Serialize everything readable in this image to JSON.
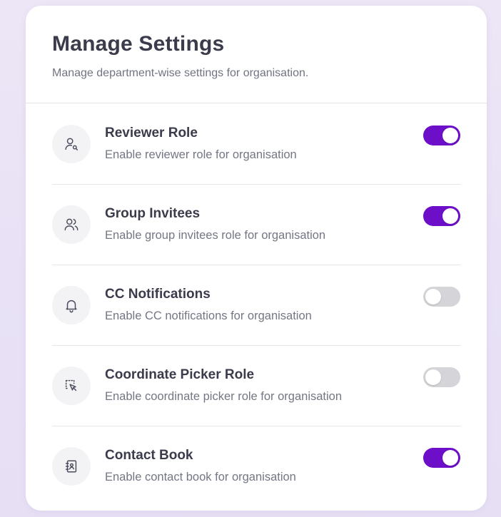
{
  "page": {
    "title": "Manage Settings",
    "subtitle": "Manage department-wise settings for organisation."
  },
  "settings": [
    {
      "icon": "user-search-icon",
      "title": "Reviewer Role",
      "description": "Enable reviewer role for organisation",
      "enabled": true
    },
    {
      "icon": "users-icon",
      "title": "Group Invitees",
      "description": "Enable group invitees role for organisation",
      "enabled": true
    },
    {
      "icon": "bell-icon",
      "title": "CC Notifications",
      "description": "Enable CC notifications for organisation",
      "enabled": false
    },
    {
      "icon": "selection-cursor-icon",
      "title": "Coordinate Picker Role",
      "description": "Enable coordinate picker role for organisation",
      "enabled": false
    },
    {
      "icon": "contact-book-icon",
      "title": "Contact Book",
      "description": "Enable contact book for organisation",
      "enabled": true
    }
  ],
  "colors": {
    "toggle_on": "#6d0fc9",
    "toggle_off": "#d5d5d9",
    "icon_stroke": "#4a4d5c"
  }
}
